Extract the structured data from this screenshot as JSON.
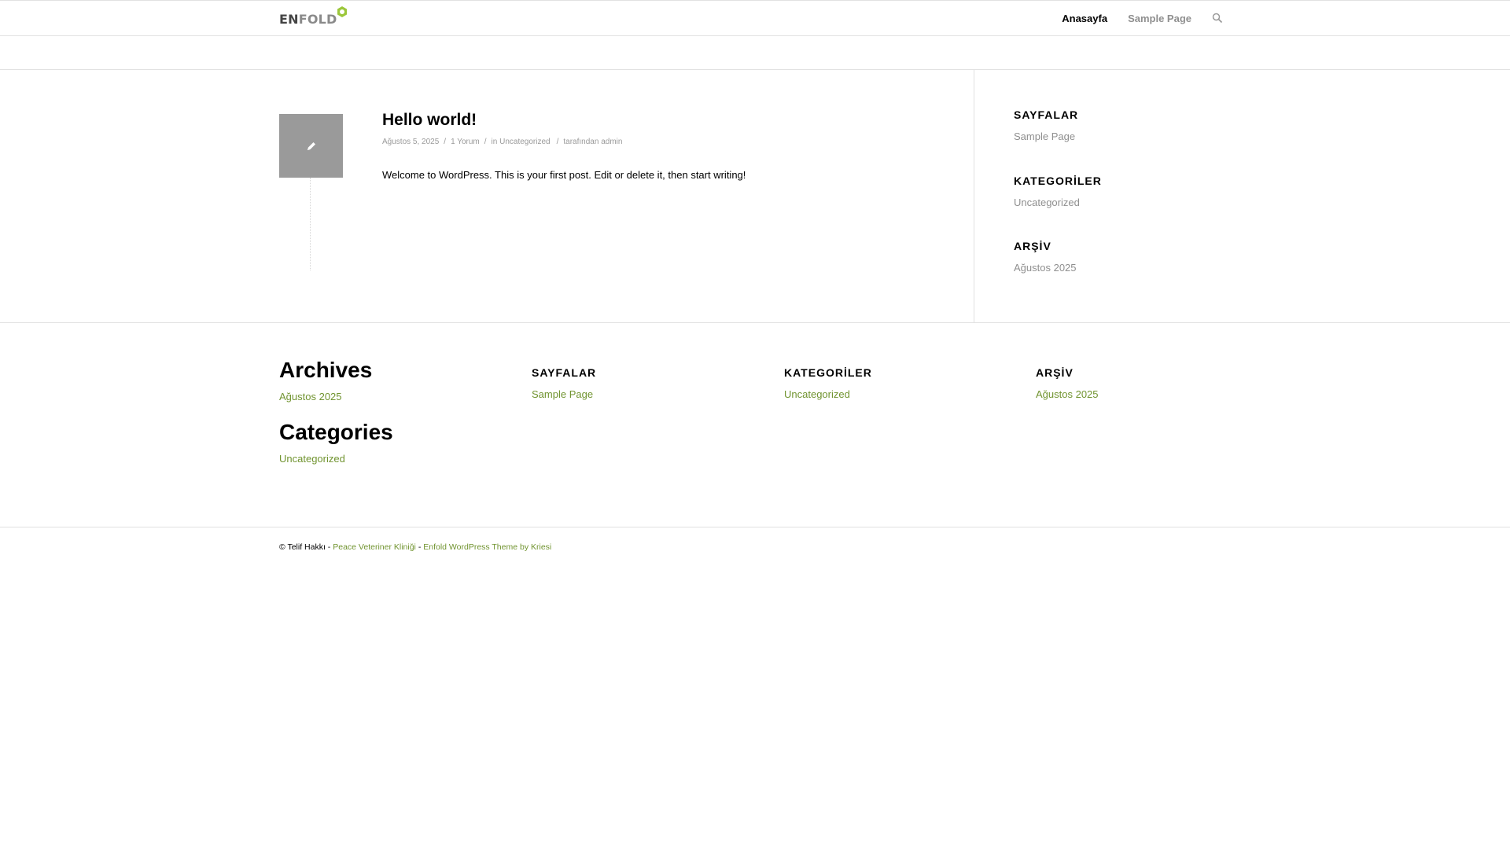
{
  "header": {
    "logo": {
      "part1": "EN",
      "part2": "FOLD"
    },
    "nav": [
      {
        "label": "Anasayfa"
      },
      {
        "label": "Sample Page"
      }
    ]
  },
  "post": {
    "title": "Hello world!",
    "date": "Ağustos 5, 2025",
    "comments": "1 Yorum",
    "in_prefix": "in",
    "category": "Uncategorized",
    "author_prefix": "tarafından",
    "author": "admin",
    "excerpt": "Welcome to WordPress. This is your first post. Edit or delete it, then start writing!"
  },
  "sidebar": [
    {
      "title": "SAYFALAR",
      "link": "Sample Page"
    },
    {
      "title": "KATEGORİLER",
      "link": "Uncategorized"
    },
    {
      "title": "ARŞİV",
      "link": "Ağustos 2025"
    }
  ],
  "footer": {
    "archives": {
      "title": "Archives",
      "link": "Ağustos 2025"
    },
    "categories": {
      "title": "Categories",
      "link": "Uncategorized"
    },
    "columns": [
      {
        "title": "SAYFALAR",
        "link": "Sample Page"
      },
      {
        "title": "KATEGORİLER",
        "link": "Uncategorized"
      },
      {
        "title": "ARŞİV",
        "link": "Ağustos 2025"
      }
    ]
  },
  "socket": {
    "copyright": "© Telif Hakkı -",
    "site": "Peace Veteriner Kliniği",
    "dash": "-",
    "theme": "Enfold WordPress Theme by Kriesi"
  },
  "colors": {
    "accent": "#719430",
    "logo_hex": "#9cc73b",
    "muted": "#8f8f8f"
  }
}
